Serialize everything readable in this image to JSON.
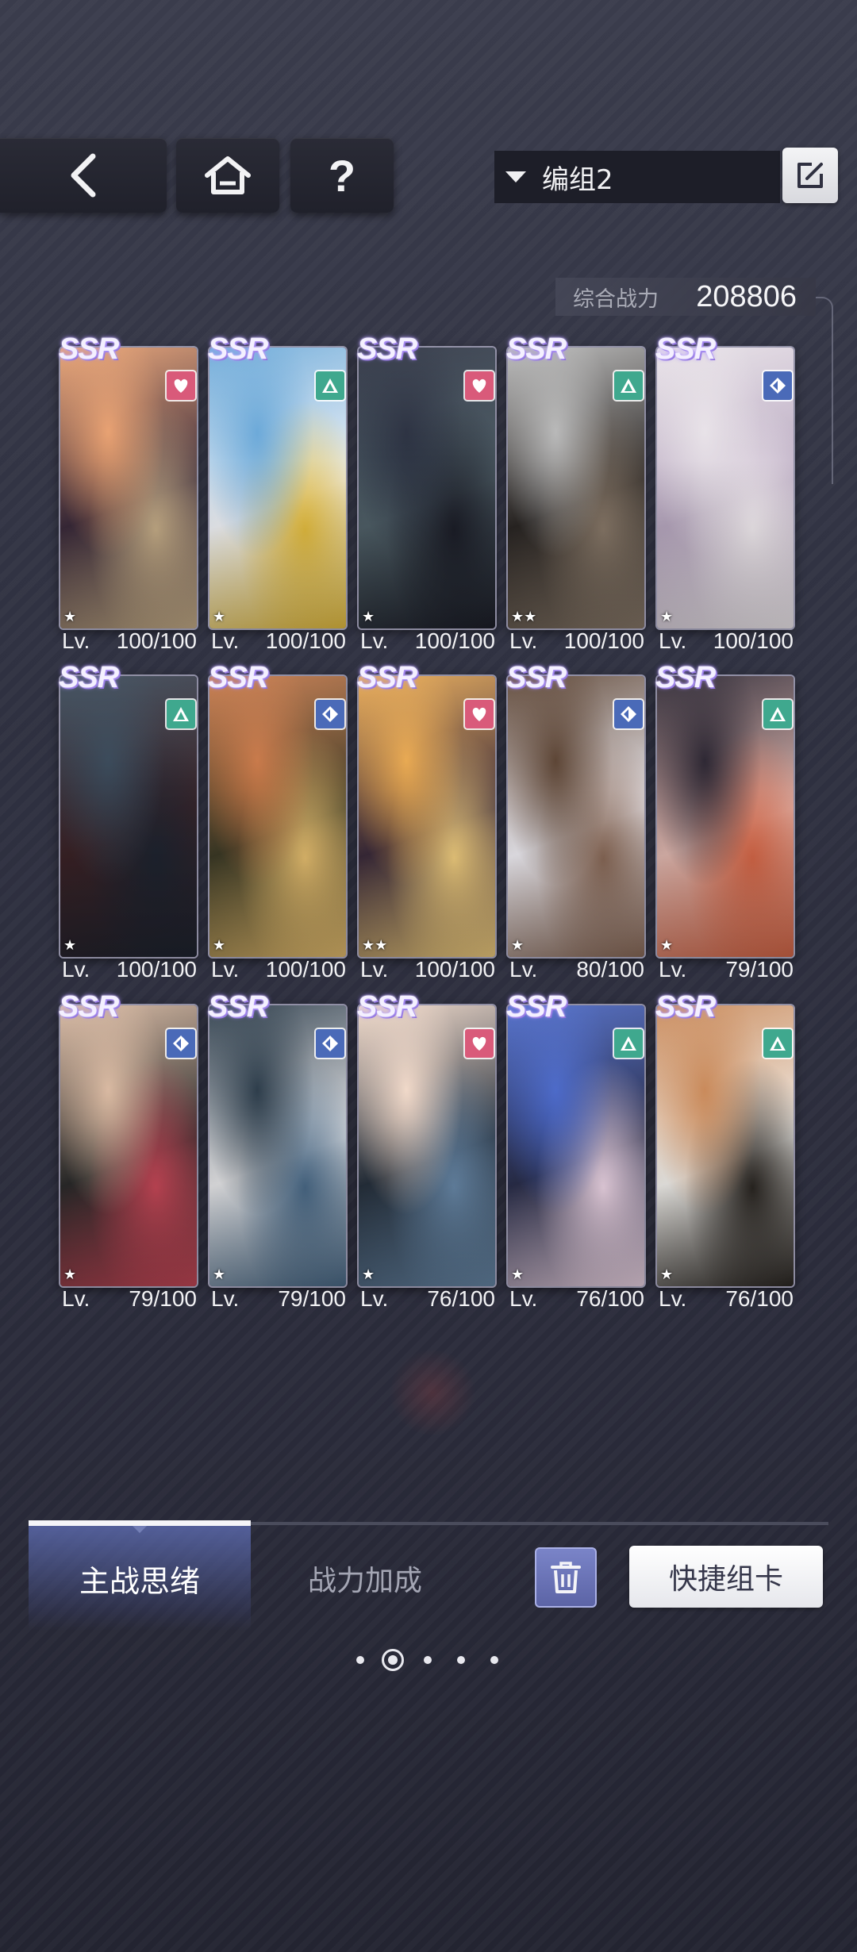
{
  "nav": {
    "help_label": "?"
  },
  "group": {
    "selected": "编组2"
  },
  "power": {
    "label": "综合战力",
    "value": "208806"
  },
  "cards": [
    {
      "rarity": "SSR",
      "badge": "heart",
      "stars": "★",
      "lv_label": "Lv.",
      "level": "100/100",
      "colors": [
        "#e8a070",
        "#3a2a3a",
        "#c9b08a"
      ]
    },
    {
      "rarity": "SSR",
      "badge": "tri",
      "stars": "★",
      "lv_label": "Lv.",
      "level": "100/100",
      "colors": [
        "#6aa8d8",
        "#f2f4f8",
        "#e8c040"
      ]
    },
    {
      "rarity": "SSR",
      "badge": "heart",
      "stars": "★",
      "lv_label": "Lv.",
      "level": "100/100",
      "colors": [
        "#2a3040",
        "#506068",
        "#1c1e28"
      ]
    },
    {
      "rarity": "SSR",
      "badge": "tri",
      "stars": "★★",
      "lv_label": "Lv.",
      "level": "100/100",
      "colors": [
        "#b8b8b8",
        "#2a2624",
        "#8a7a6a"
      ]
    },
    {
      "rarity": "SSR",
      "badge": "diamond",
      "stars": "★",
      "lv_label": "Lv.",
      "level": "100/100",
      "colors": [
        "#e8e2e8",
        "#b8a8c0",
        "#f4eef2"
      ]
    },
    {
      "rarity": "SSR",
      "badge": "tri",
      "stars": "★",
      "lv_label": "Lv.",
      "level": "100/100",
      "colors": [
        "#384858",
        "#3a2226",
        "#1e2430"
      ]
    },
    {
      "rarity": "SSR",
      "badge": "diamond",
      "stars": "★",
      "lv_label": "Lv.",
      "level": "100/100",
      "colors": [
        "#c87848",
        "#3c3a26",
        "#e8c070"
      ]
    },
    {
      "rarity": "SSR",
      "badge": "heart",
      "stars": "★★",
      "lv_label": "Lv.",
      "level": "100/100",
      "colors": [
        "#e8a850",
        "#3a2a3a",
        "#f4d080"
      ]
    },
    {
      "rarity": "SSR",
      "badge": "diamond",
      "stars": "★",
      "lv_label": "Lv.",
      "level": "80/100",
      "colors": [
        "#5a4232",
        "#f0eef4",
        "#8a6a58"
      ]
    },
    {
      "rarity": "SSR",
      "badge": "tri",
      "stars": "★",
      "lv_label": "Lv.",
      "level": "79/100",
      "colors": [
        "#2a2430",
        "#e0b8b0",
        "#d86848"
      ]
    },
    {
      "rarity": "SSR",
      "badge": "diamond",
      "stars": "★",
      "lv_label": "Lv.",
      "level": "79/100",
      "colors": [
        "#d8b8a0",
        "#2a2a2a",
        "#c84858"
      ]
    },
    {
      "rarity": "SSR",
      "badge": "diamond",
      "stars": "★",
      "lv_label": "Lv.",
      "level": "79/100",
      "colors": [
        "#2a3a48",
        "#e8e8ea",
        "#4a6a88"
      ]
    },
    {
      "rarity": "SSR",
      "badge": "heart",
      "stars": "★",
      "lv_label": "Lv.",
      "level": "76/100",
      "colors": [
        "#f0d8c8",
        "#26303c",
        "#6888a8"
      ]
    },
    {
      "rarity": "SSR",
      "badge": "tri",
      "stars": "★",
      "lv_label": "Lv.",
      "level": "76/100",
      "colors": [
        "#4a68c8",
        "#2a2e4a",
        "#f0d8e8"
      ]
    },
    {
      "rarity": "SSR",
      "badge": "tri",
      "stars": "★",
      "lv_label": "Lv.",
      "level": "76/100",
      "colors": [
        "#c88858",
        "#f2f0ec",
        "#2a2622"
      ]
    }
  ],
  "tabs": {
    "active": "主战思绪",
    "inactive": "战力加成"
  },
  "actions": {
    "quick_label": "快捷组卡",
    "trash_icon": "trash-icon"
  },
  "pager": {
    "count": 5,
    "active_index": 1
  }
}
